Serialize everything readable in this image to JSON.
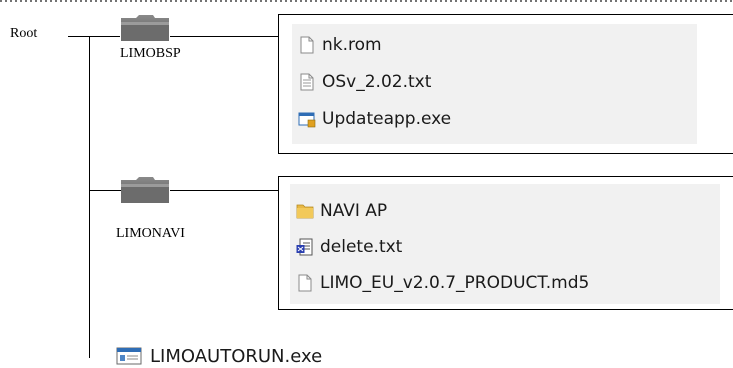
{
  "tree": {
    "root": {
      "label": "Root"
    },
    "folders": [
      {
        "id": "limobsp",
        "label": "LIMOBSP",
        "icon": "folder-icon",
        "files": [
          {
            "name": "nk.rom",
            "icon": "blank-file-icon"
          },
          {
            "name": "OSv_2.02.txt",
            "icon": "text-file-icon"
          },
          {
            "name": "Updateapp.exe",
            "icon": "exe-app-icon"
          }
        ]
      },
      {
        "id": "limonavi",
        "label": "LIMONAVI",
        "icon": "folder-icon",
        "files": [
          {
            "name": "NAVI AP",
            "icon": "yellow-folder-icon"
          },
          {
            "name": "delete.txt",
            "icon": "text-document-icon"
          },
          {
            "name": "LIMO_EU_v2.0.7_PRODUCT.md5",
            "icon": "blank-file-icon"
          }
        ]
      }
    ],
    "root_file": {
      "name": "LIMOAUTORUN.exe",
      "icon": "exe-window-icon"
    }
  },
  "colors": {
    "line": "#000000",
    "folder_dark": "#6e6e6e",
    "folder_light": "#9a9a9a",
    "panel_shade": "#f1f1f1",
    "yellow_folder": "#e8b845",
    "exe_blue": "#2f6db5"
  }
}
